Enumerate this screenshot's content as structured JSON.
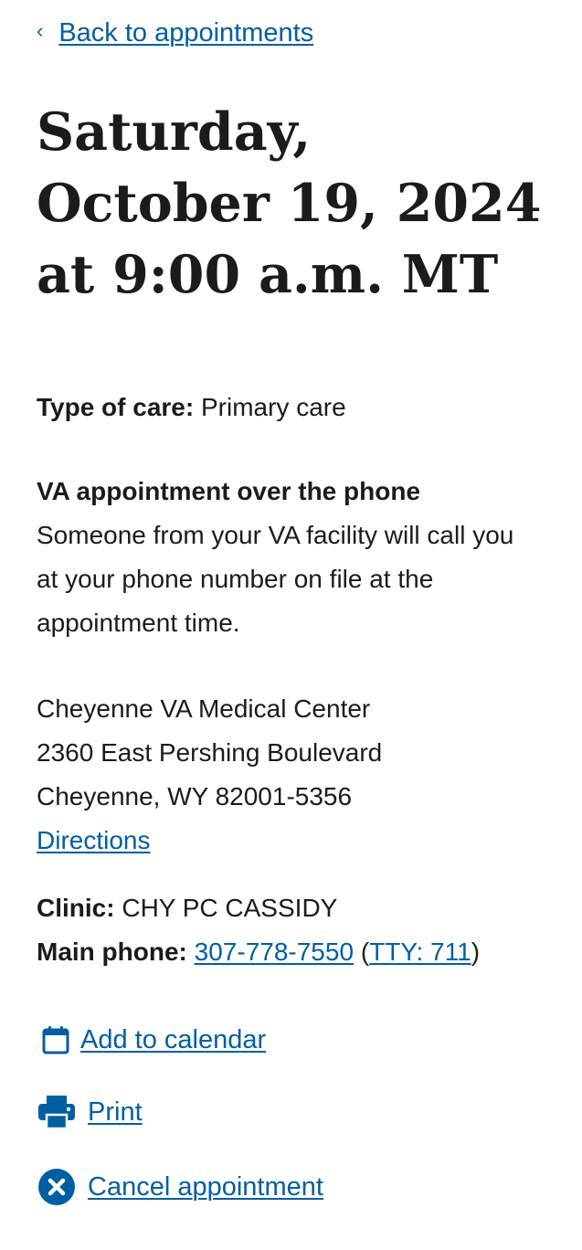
{
  "nav": {
    "back_label": "Back to appointments"
  },
  "appointment": {
    "title": "Saturday, October 19, 2024 at 9:00 a.m. MT",
    "type_of_care_label": "Type of care:",
    "type_of_care_value": "Primary care",
    "modality_heading": "VA appointment over the phone",
    "modality_description": "Someone from your VA facility will call you at your phone number on file at the appointment time."
  },
  "facility": {
    "name": "Cheyenne VA Medical Center",
    "address_line1": "2360 East Pershing Boulevard",
    "address_line2": "Cheyenne, WY 82001-5356",
    "directions_label": "Directions"
  },
  "clinic": {
    "clinic_label": "Clinic:",
    "clinic_value": "CHY PC CASSIDY",
    "phone_label": "Main phone:",
    "phone_value": "307-778-7550",
    "tty_value": "TTY: 711"
  },
  "actions": {
    "add_to_calendar": "Add to calendar",
    "print": "Print",
    "cancel": "Cancel appointment"
  },
  "colors": {
    "link": "#005ea2",
    "text": "#1b1b1b"
  }
}
